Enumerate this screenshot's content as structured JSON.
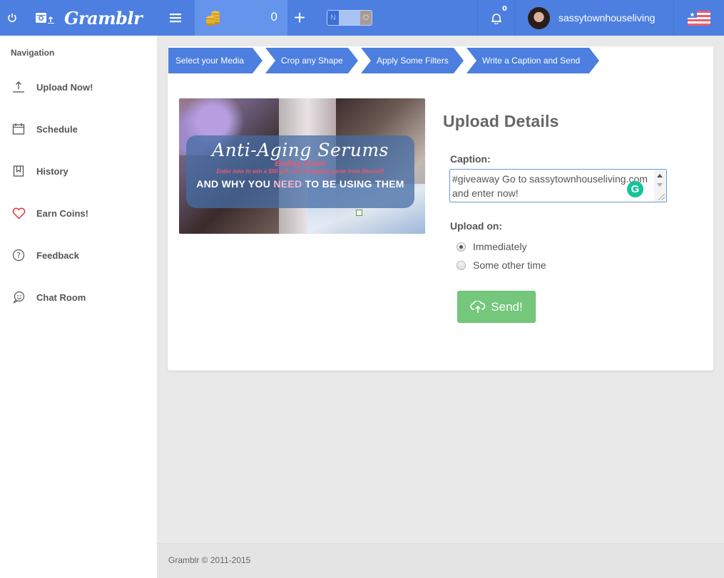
{
  "app": {
    "name": "Gramblr",
    "accent_color": "#4c7fe0",
    "success_color": "#74c77b"
  },
  "topbar": {
    "power_icon": "power-icon",
    "brand_icon": "instagram-upload-icon",
    "brand": "Gramblr",
    "menu_icon": "hamburger-icon",
    "coins_icon": "coins-icon",
    "coin_count": "0",
    "add_label": "+",
    "toggle": {
      "left": "N",
      "right": "O"
    },
    "notifications_icon": "bell-icon",
    "notifications_count": "0",
    "username": "sassytownhouseliving",
    "language_icon": "us-flag-icon"
  },
  "sidebar": {
    "title": "Navigation",
    "items": [
      {
        "label": "Upload Now!",
        "icon": "upload-icon"
      },
      {
        "label": "Schedule",
        "icon": "calendar-icon"
      },
      {
        "label": "History",
        "icon": "bookmark-icon"
      },
      {
        "label": "Earn Coins!",
        "icon": "heart-icon"
      },
      {
        "label": "Feedback",
        "icon": "question-icon"
      },
      {
        "label": "Chat Room",
        "icon": "chat-icon"
      }
    ]
  },
  "steps": [
    {
      "label": "Select your Media"
    },
    {
      "label": "Crop any Shape"
    },
    {
      "label": "Apply Some Filters"
    },
    {
      "label": "Write a Caption and Send"
    }
  ],
  "media": {
    "title": "Anti-Aging Serums",
    "line1": "Ending Soon!",
    "line2": "Enter now to win a $50 gift card shopping spree from Neocell!",
    "line3_pre": "AND WHY YOU ",
    "line3_hl": "NEED",
    "line3_post": " TO BE USING THEM"
  },
  "upload": {
    "heading": "Upload Details",
    "caption_label": "Caption:",
    "caption_value": "#giveaway Go to sassytownhouseliving.com and enter now!",
    "upload_on_label": "Upload on:",
    "options": [
      {
        "label": "Immediately",
        "checked": true
      },
      {
        "label": "Some other time",
        "checked": false
      }
    ],
    "send_label": "Send!"
  },
  "footer": {
    "text": "Gramblr © 2011-2015"
  }
}
